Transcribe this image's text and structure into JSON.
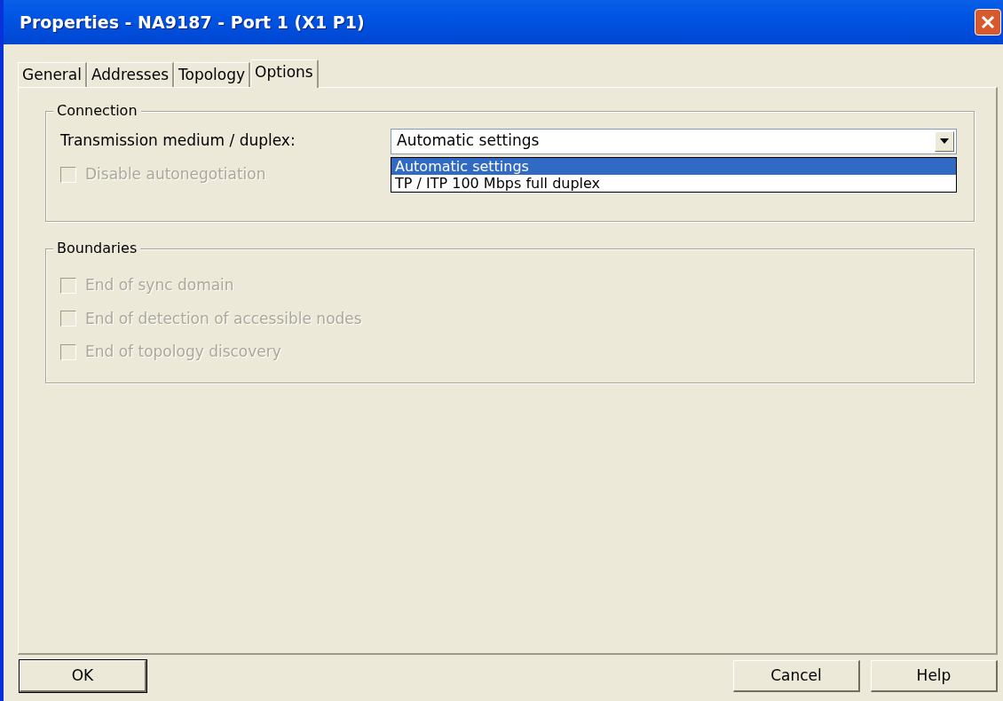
{
  "window": {
    "title": "Properties - NA9187 - Port 1 (X1 P1)"
  },
  "tabs": [
    {
      "label": "General",
      "selected": false
    },
    {
      "label": "Addresses",
      "selected": false
    },
    {
      "label": "Topology",
      "selected": false
    },
    {
      "label": "Options",
      "selected": true
    }
  ],
  "connection": {
    "title": "Connection",
    "medium_label": "Transmission medium / duplex:",
    "medium_value": "Automatic settings",
    "options": [
      {
        "label": "Automatic settings",
        "selected": true
      },
      {
        "label": "TP / ITP 100 Mbps full duplex",
        "selected": false
      }
    ],
    "checkboxes": [
      {
        "label": "Disable autonegotiation",
        "checked": false,
        "disabled": true
      }
    ]
  },
  "boundaries": {
    "title": "Boundaries",
    "checkboxes": [
      {
        "label": "End of sync domain",
        "checked": false,
        "disabled": true
      },
      {
        "label": "End of detection of accessible nodes",
        "checked": false,
        "disabled": true
      },
      {
        "label": "End of topology discovery",
        "checked": false,
        "disabled": true
      }
    ]
  },
  "buttons": [
    {
      "label": "OK",
      "default": true
    },
    {
      "label": "Cancel",
      "default": false
    },
    {
      "label": "Help",
      "default": false
    }
  ]
}
